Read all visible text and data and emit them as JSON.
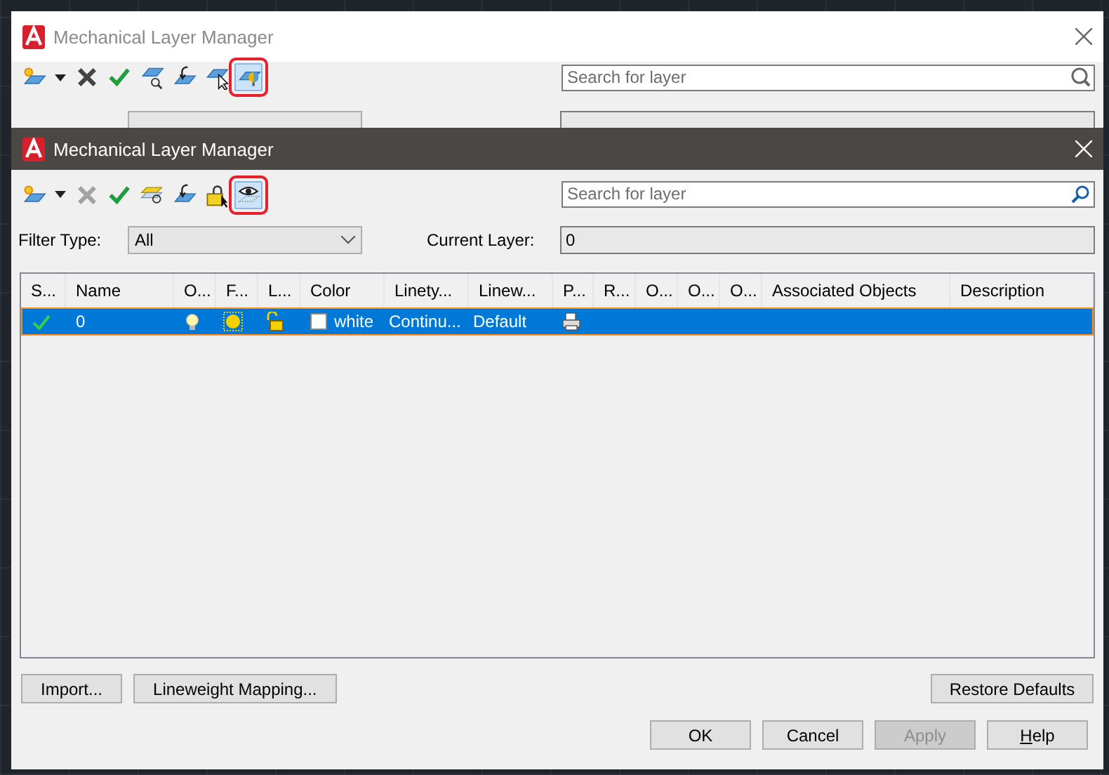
{
  "back_dialog": {
    "title": "Mechanical Layer Manager",
    "toolbar": [
      {
        "kind": "new-layer",
        "selected": false,
        "disabled": false
      },
      {
        "kind": "caret",
        "selected": false,
        "disabled": false
      },
      {
        "kind": "delete",
        "selected": false,
        "disabled": false
      },
      {
        "kind": "set-current",
        "selected": false,
        "disabled": false
      },
      {
        "kind": "find-layer",
        "selected": false,
        "disabled": false
      },
      {
        "kind": "restore",
        "selected": false,
        "disabled": false
      },
      {
        "kind": "select-layer",
        "selected": false,
        "disabled": false
      },
      {
        "kind": "isolate",
        "selected": true,
        "disabled": false
      }
    ],
    "search": {
      "placeholder": "Search for layer"
    }
  },
  "dialog": {
    "title": "Mechanical Layer Manager",
    "toolbar": [
      {
        "kind": "new-layer",
        "selected": false,
        "disabled": false
      },
      {
        "kind": "caret",
        "selected": false,
        "disabled": false
      },
      {
        "kind": "delete",
        "selected": false,
        "disabled": true
      },
      {
        "kind": "set-current",
        "selected": false,
        "disabled": false
      },
      {
        "kind": "layer-states",
        "selected": false,
        "disabled": false
      },
      {
        "kind": "restore",
        "selected": false,
        "disabled": false
      },
      {
        "kind": "lock",
        "selected": false,
        "disabled": false
      },
      {
        "kind": "visibility",
        "selected": true,
        "disabled": false
      }
    ],
    "search": {
      "placeholder": "Search for layer"
    },
    "filter_type_label": "Filter Type:",
    "filter_type": "All",
    "current_layer_label": "Current Layer:",
    "current_layer": "0",
    "table": {
      "columns": [
        "S...",
        "Name",
        "O...",
        "F...",
        "L...",
        "Color",
        "Linety...",
        "Linew...",
        "P...",
        "R...",
        "O...",
        "O...",
        "O...",
        "Associated Objects",
        "Description"
      ],
      "rows": [
        {
          "selected": true,
          "current": true,
          "name": "0",
          "on": true,
          "frozen": false,
          "locked": false,
          "color": "#ffffff",
          "color_name": "white",
          "linetype": "Continu...",
          "lineweight": "Default",
          "plot": true
        }
      ]
    },
    "left_buttons": [
      {
        "label": "Import...",
        "disabled": false
      },
      {
        "label": "Lineweight Mapping...",
        "disabled": false
      }
    ],
    "restore_button": {
      "label": "Restore Defaults",
      "disabled": false
    },
    "buttons": [
      {
        "label": "OK",
        "disabled": false,
        "underline_first": false
      },
      {
        "label": "Cancel",
        "disabled": false,
        "underline_first": false
      },
      {
        "label": "Apply",
        "disabled": true,
        "underline_first": false
      },
      {
        "label": "Help",
        "disabled": false,
        "underline_first": true
      }
    ]
  }
}
